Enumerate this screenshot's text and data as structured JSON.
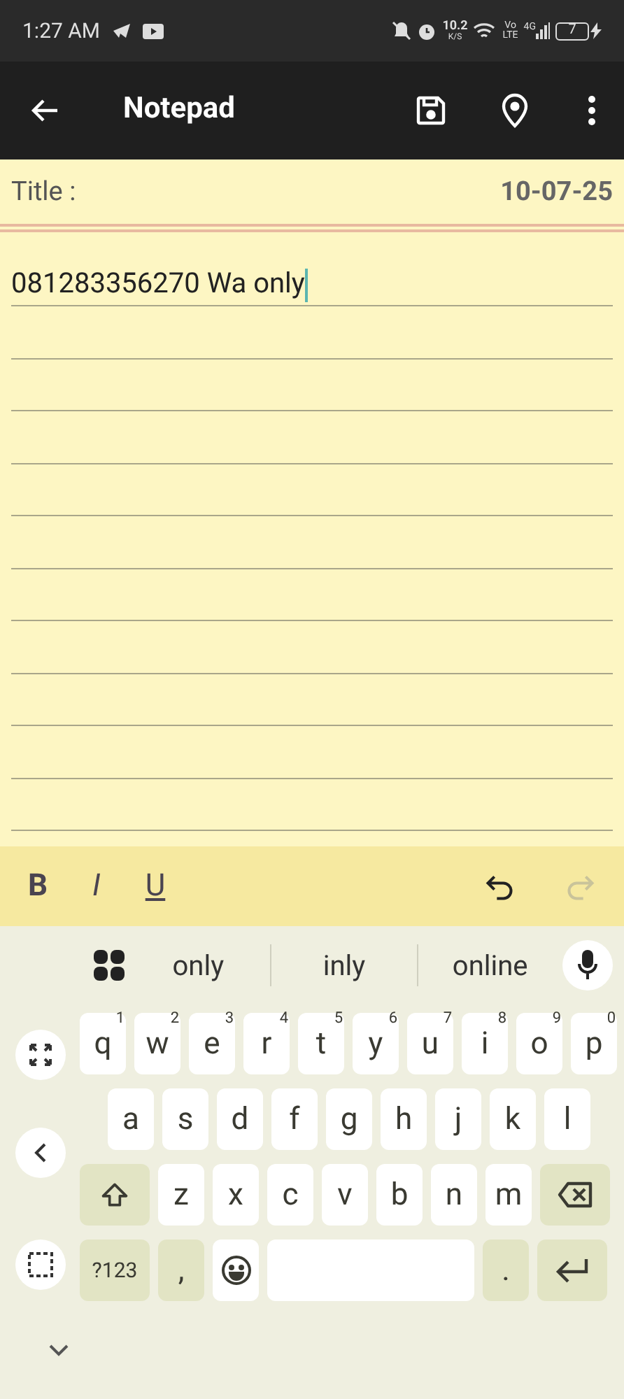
{
  "status_bar": {
    "time": "1:27 AM",
    "speed": "10.2",
    "speed_unit": "K/S",
    "volte_top": "Vo",
    "volte_bottom": "LTE",
    "network": "4G",
    "battery": "7"
  },
  "app_bar": {
    "title": "Notepad"
  },
  "note": {
    "title_label": "Title :",
    "date": "10-07-25",
    "body": "081283356270 Wa only"
  },
  "format_toolbar": [
    {
      "label": "B",
      "kind": "bold",
      "disabled": false
    },
    {
      "label": "I",
      "kind": "italic",
      "disabled": false
    },
    {
      "label": "U",
      "kind": "underline",
      "disabled": false
    }
  ],
  "history": [
    {
      "kind": "undo",
      "disabled": false
    },
    {
      "kind": "redo",
      "disabled": true
    }
  ],
  "suggestions": [
    "only",
    "inly",
    "online"
  ],
  "keyboard": {
    "rows": [
      [
        {
          "label": "q",
          "hint": "1"
        },
        {
          "label": "w",
          "hint": "2"
        },
        {
          "label": "e",
          "hint": "3"
        },
        {
          "label": "r",
          "hint": "4"
        },
        {
          "label": "t",
          "hint": "5"
        },
        {
          "label": "y",
          "hint": "6"
        },
        {
          "label": "u",
          "hint": "7"
        },
        {
          "label": "i",
          "hint": "8"
        },
        {
          "label": "o",
          "hint": "9"
        },
        {
          "label": "p",
          "hint": "0"
        }
      ],
      [
        {
          "label": "a"
        },
        {
          "label": "s"
        },
        {
          "label": "d"
        },
        {
          "label": "f"
        },
        {
          "label": "g"
        },
        {
          "label": "h"
        },
        {
          "label": "j"
        },
        {
          "label": "k"
        },
        {
          "label": "l"
        }
      ],
      [
        {
          "kind": "shift"
        },
        {
          "label": "z"
        },
        {
          "label": "x"
        },
        {
          "label": "c"
        },
        {
          "label": "v"
        },
        {
          "label": "b"
        },
        {
          "label": "n"
        },
        {
          "label": "m"
        },
        {
          "kind": "backspace"
        }
      ],
      [
        {
          "kind": "symbols",
          "label": "?123"
        },
        {
          "kind": "comma",
          "label": ","
        },
        {
          "kind": "emoji"
        },
        {
          "kind": "space"
        },
        {
          "kind": "period",
          "label": "."
        },
        {
          "kind": "enter"
        }
      ]
    ]
  }
}
